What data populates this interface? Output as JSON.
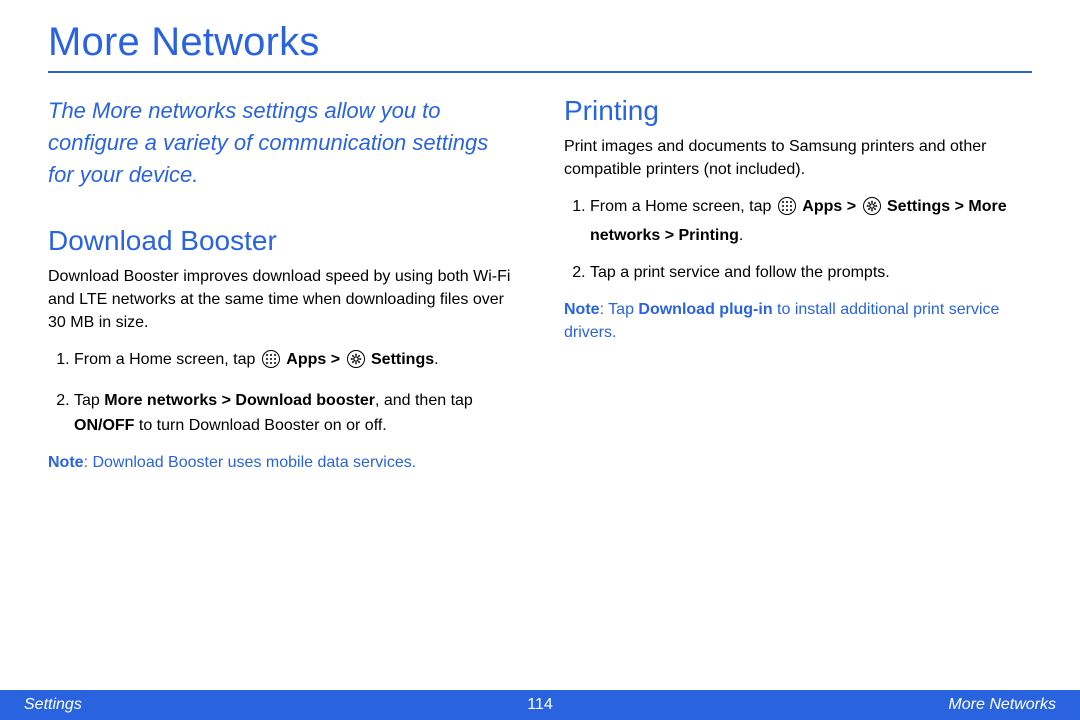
{
  "title": "More Networks",
  "intro": "The More networks settings allow you to configure a variety of communication settings for your device.",
  "left": {
    "heading": "Download Booster",
    "desc": "Download Booster improves download speed by using both Wi-Fi and LTE networks at the same time when downloading files over 30 MB in size.",
    "step1_prefix": "From a Home screen, tap ",
    "step1_apps": "Apps",
    "step1_gt": " > ",
    "step1_settings": "Settings",
    "step1_suffix": ".",
    "step2_a": "Tap ",
    "step2_b": "More networks > Download booster",
    "step2_c": ", and then tap ",
    "step2_d": "ON/OFF",
    "step2_e": " to turn Download Booster on or off.",
    "note_label": "Note",
    "note_text": ": Download Booster uses mobile data services."
  },
  "right": {
    "heading": "Printing",
    "desc": "Print images and documents to Samsung printers and other compatible printers (not included).",
    "step1_prefix": "From a Home screen, tap ",
    "step1_apps": "Apps",
    "step1_gt": " > ",
    "step1_settings": "Settings",
    "step1_after": " > More networks > Printing",
    "step1_suffix": ".",
    "step2": "Tap a print service and follow the prompts.",
    "note_label": "Note",
    "note_a": ": Tap ",
    "note_b": "Download plug-in",
    "note_c": " to install additional print service drivers."
  },
  "footer": {
    "left": "Settings",
    "center": "114",
    "right": "More Networks"
  }
}
